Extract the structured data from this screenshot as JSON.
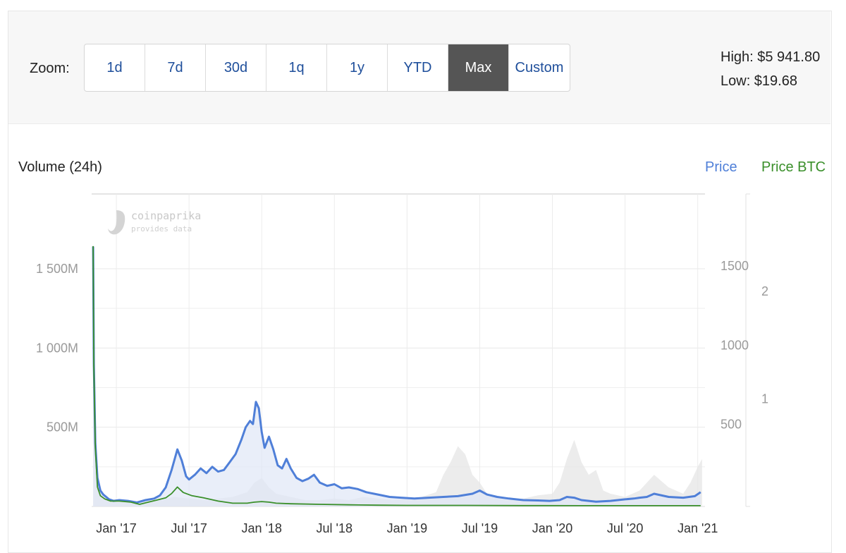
{
  "toolbar": {
    "zoom_label": "Zoom:",
    "buttons": [
      "1d",
      "7d",
      "30d",
      "1q",
      "1y",
      "YTD",
      "Max",
      "Custom"
    ],
    "active": "Max",
    "high": "High: $5 941.80",
    "low": "Low: $19.68"
  },
  "watermark": {
    "line1": "coinpaprika",
    "line2": "provides data"
  },
  "colors": {
    "price": "#4f7fd8",
    "price_fill": "#dfe7f7",
    "btc": "#3a8f2a",
    "volume": "#e6e6e6"
  },
  "chart_data": {
    "type": "line",
    "left_axis": {
      "title": "Volume (24h)",
      "ticks": [
        "1 500M",
        "1 000M",
        "500M"
      ],
      "tick_values": [
        1500,
        1000,
        500
      ]
    },
    "right_axis_price": {
      "ticks": [
        "1500",
        "1000",
        "500"
      ],
      "tick_values": [
        1500,
        1000,
        500
      ]
    },
    "right_axis_btc": {
      "ticks": [
        "2",
        "1"
      ],
      "tick_values": [
        2,
        1
      ]
    },
    "x_ticks": [
      "Jan '17",
      "Jul '17",
      "Jan '18",
      "Jul '18",
      "Jan '19",
      "Jul '19",
      "Jan '20",
      "Jul '20",
      "Jan '21"
    ],
    "x_tick_pos": [
      2017.0,
      2017.5,
      2018.0,
      2018.5,
      2019.0,
      2019.5,
      2020.0,
      2020.5,
      2021.0
    ],
    "x_range": [
      2016.83,
      2021.05
    ],
    "series": [
      {
        "name": "Price",
        "axis": "price",
        "x": [
          2016.84,
          2016.845,
          2016.855,
          2016.87,
          2016.89,
          2016.91,
          2016.93,
          2016.95,
          2016.98,
          2017.02,
          2017.08,
          2017.14,
          2017.2,
          2017.26,
          2017.3,
          2017.34,
          2017.38,
          2017.42,
          2017.45,
          2017.48,
          2017.5,
          2017.54,
          2017.58,
          2017.62,
          2017.66,
          2017.7,
          2017.74,
          2017.78,
          2017.82,
          2017.86,
          2017.89,
          2017.92,
          2017.94,
          2017.96,
          2017.98,
          2018.0,
          2018.02,
          2018.05,
          2018.08,
          2018.11,
          2018.14,
          2018.17,
          2018.2,
          2018.24,
          2018.28,
          2018.32,
          2018.36,
          2018.4,
          2018.45,
          2018.5,
          2018.55,
          2018.6,
          2018.66,
          2018.72,
          2018.8,
          2018.88,
          2018.96,
          2019.05,
          2019.15,
          2019.25,
          2019.35,
          2019.45,
          2019.5,
          2019.55,
          2019.62,
          2019.7,
          2019.8,
          2019.9,
          2019.98,
          2020.05,
          2020.1,
          2020.15,
          2020.2,
          2020.3,
          2020.4,
          2020.5,
          2020.56,
          2020.6,
          2020.65,
          2020.7,
          2020.8,
          2020.9,
          2020.98,
          2021.02
        ],
        "y": [
          1640,
          900,
          400,
          180,
          100,
          75,
          60,
          45,
          35,
          40,
          35,
          25,
          40,
          50,
          70,
          120,
          230,
          360,
          290,
          190,
          170,
          200,
          240,
          210,
          250,
          220,
          230,
          280,
          330,
          420,
          500,
          540,
          520,
          660,
          620,
          470,
          370,
          440,
          360,
          260,
          240,
          300,
          240,
          180,
          160,
          175,
          200,
          150,
          130,
          140,
          115,
          120,
          110,
          90,
          75,
          60,
          55,
          50,
          55,
          60,
          65,
          80,
          100,
          75,
          60,
          50,
          40,
          38,
          35,
          40,
          60,
          55,
          40,
          30,
          35,
          45,
          50,
          55,
          60,
          80,
          60,
          55,
          65,
          90
        ]
      },
      {
        "name": "Price BTC",
        "axis": "btc",
        "x": [
          2016.84,
          2016.845,
          2016.855,
          2016.87,
          2016.89,
          2016.92,
          2016.96,
          2017.02,
          2017.1,
          2017.16,
          2017.22,
          2017.28,
          2017.34,
          2017.38,
          2017.42,
          2017.46,
          2017.52,
          2017.6,
          2017.7,
          2017.8,
          2017.9,
          2017.95,
          2018.0,
          2018.05,
          2018.1,
          2018.2,
          2018.4,
          2018.6,
          2018.8,
          2019.0,
          2019.4,
          2019.8,
          2020.2,
          2020.6,
          2021.02
        ],
        "y": [
          2.42,
          1.3,
          0.55,
          0.18,
          0.1,
          0.07,
          0.05,
          0.05,
          0.04,
          0.02,
          0.04,
          0.06,
          0.08,
          0.12,
          0.18,
          0.13,
          0.1,
          0.08,
          0.05,
          0.03,
          0.03,
          0.04,
          0.045,
          0.04,
          0.03,
          0.025,
          0.02,
          0.015,
          0.012,
          0.01,
          0.01,
          0.008,
          0.007,
          0.007,
          0.007
        ]
      },
      {
        "name": "Volume (24h)",
        "axis": "volume",
        "x": [
          2016.84,
          2016.85,
          2016.87,
          2016.9,
          2016.95,
          2017.0,
          2017.1,
          2017.2,
          2017.3,
          2017.4,
          2017.5,
          2017.6,
          2017.7,
          2017.8,
          2017.9,
          2017.95,
          2018.0,
          2018.05,
          2018.1,
          2018.2,
          2018.3,
          2018.4,
          2018.5,
          2018.6,
          2018.7,
          2018.8,
          2018.9,
          2019.0,
          2019.1,
          2019.2,
          2019.25,
          2019.3,
          2019.35,
          2019.4,
          2019.45,
          2019.5,
          2019.55,
          2019.6,
          2019.7,
          2019.8,
          2019.9,
          2020.0,
          2020.05,
          2020.1,
          2020.15,
          2020.2,
          2020.25,
          2020.3,
          2020.35,
          2020.4,
          2020.5,
          2020.6,
          2020.7,
          2020.8,
          2020.9,
          2020.95,
          2021.0,
          2021.03
        ],
        "y": [
          1300,
          600,
          200,
          80,
          50,
          40,
          30,
          30,
          40,
          60,
          50,
          40,
          50,
          60,
          90,
          150,
          180,
          120,
          80,
          60,
          40,
          40,
          50,
          40,
          60,
          50,
          40,
          50,
          60,
          90,
          200,
          280,
          380,
          330,
          200,
          150,
          80,
          60,
          40,
          50,
          70,
          80,
          150,
          300,
          420,
          280,
          200,
          230,
          100,
          80,
          60,
          100,
          200,
          120,
          80,
          150,
          250,
          300
        ]
      }
    ]
  }
}
